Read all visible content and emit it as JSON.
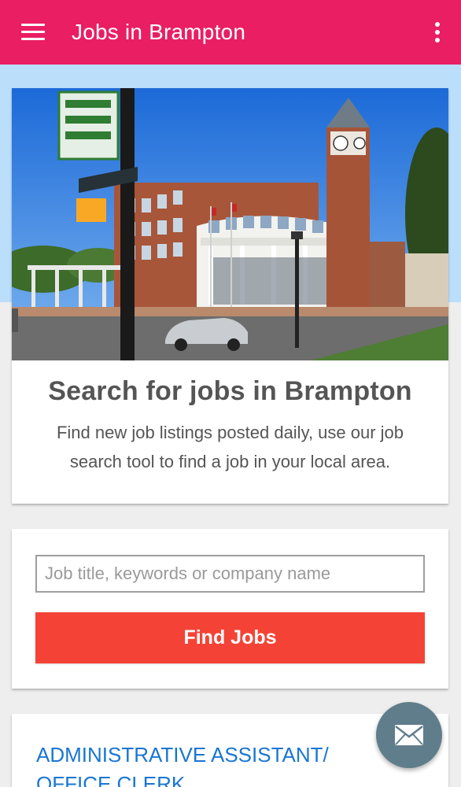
{
  "app_bar": {
    "title": "Jobs in Brampton",
    "menu_icon": "hamburger-menu-icon",
    "overflow_icon": "more-vert-icon",
    "color": "#e91e63"
  },
  "hero": {
    "image_subject": "Brampton City Hall building with clock tower",
    "title": "Search for jobs in Brampton",
    "description": "Find new job listings posted daily, use our job search tool to find a job in your local area.",
    "band_color": "#bbdefb"
  },
  "search": {
    "value": "",
    "placeholder": "Job title, keywords or company name",
    "button_label": "Find Jobs",
    "button_color": "#f44336"
  },
  "job_listing": {
    "title": "ADMINISTRATIVE ASSISTANT/ OFFICE CLERK...",
    "link_color": "#1976d2"
  },
  "fab": {
    "icon": "mail-icon",
    "color": "#607d8b"
  }
}
